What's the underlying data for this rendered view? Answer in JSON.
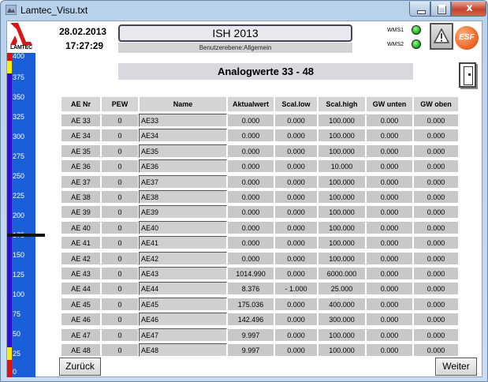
{
  "window": {
    "title": "Lamtec_Visu.txt",
    "close_glyph": "x"
  },
  "logo": {
    "text": "LAMTEC"
  },
  "gauge": {
    "ticks": [
      "400",
      "375",
      "350",
      "325",
      "300",
      "275",
      "250",
      "225",
      "200",
      "175",
      "150",
      "125",
      "100",
      "75",
      "50",
      "25",
      "0"
    ],
    "colors": {
      "bar": "#1a5fd8",
      "low_high_alarm": "#e01010",
      "warning": "#ffee00"
    }
  },
  "header": {
    "date": "28.02.2013",
    "time": "17:27:29",
    "system_name": "ISH 2013",
    "user_level": "Benutzerebene:Allgemein",
    "wms1_label": "WMS1",
    "wms2_label": "WMS2",
    "esf_label": "ESF",
    "page_title": "Analogwerte 33 - 48"
  },
  "table": {
    "columns": [
      "AE Nr",
      "PEW",
      "Name",
      "Aktualwert",
      "Scal.low",
      "Scal.high",
      "GW unten",
      "GW oben"
    ],
    "rows": [
      [
        "AE 33",
        "0",
        "AE33",
        "0.000",
        "0.000",
        "100.000",
        "0.000",
        "0.000"
      ],
      [
        "AE 34",
        "0",
        "AE34",
        "0.000",
        "0.000",
        "100.000",
        "0.000",
        "0.000"
      ],
      [
        "AE 35",
        "0",
        "AE35",
        "0.000",
        "0.000",
        "100.000",
        "0.000",
        "0.000"
      ],
      [
        "AE 36",
        "0",
        "AE36",
        "0.000",
        "0.000",
        "10.000",
        "0.000",
        "0.000"
      ],
      [
        "AE 37",
        "0",
        "AE37",
        "0.000",
        "0.000",
        "100.000",
        "0.000",
        "0.000"
      ],
      [
        "AE 38",
        "0",
        "AE38",
        "0.000",
        "0.000",
        "100.000",
        "0.000",
        "0.000"
      ],
      [
        "AE 39",
        "0",
        "AE39",
        "0.000",
        "0.000",
        "100.000",
        "0.000",
        "0.000"
      ],
      [
        "AE 40",
        "0",
        "AE40",
        "0.000",
        "0.000",
        "100.000",
        "0.000",
        "0.000"
      ],
      [
        "AE 41",
        "0",
        "AE41",
        "0.000",
        "0.000",
        "100.000",
        "0.000",
        "0.000"
      ],
      [
        "AE 42",
        "0",
        "AE42",
        "0.000",
        "0.000",
        "100.000",
        "0.000",
        "0.000"
      ],
      [
        "AE 43",
        "0",
        "AE43",
        "1014.990",
        "0.000",
        "6000.000",
        "0.000",
        "0.000"
      ],
      [
        "AE 44",
        "0",
        "AE44",
        "8.376",
        "- 1.000",
        "25.000",
        "0.000",
        "0.000"
      ],
      [
        "AE 45",
        "0",
        "AE45",
        "175.036",
        "0.000",
        "400.000",
        "0.000",
        "0.000"
      ],
      [
        "AE 46",
        "0",
        "AE46",
        "142.496",
        "0.000",
        "300.000",
        "0.000",
        "0.000"
      ],
      [
        "AE 47",
        "0",
        "AE47",
        "9.997",
        "0.000",
        "100.000",
        "0.000",
        "0.000"
      ],
      [
        "AE 48",
        "0",
        "AE48",
        "9.997",
        "0.000",
        "100.000",
        "0.000",
        "0.000"
      ]
    ]
  },
  "footer": {
    "back_label": "Zurück",
    "next_label": "Weiter"
  }
}
